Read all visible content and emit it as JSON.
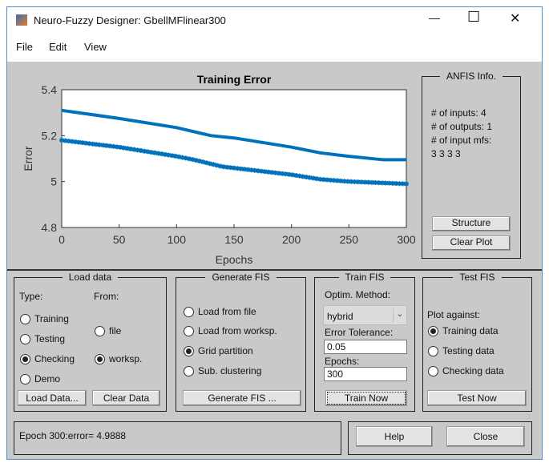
{
  "window": {
    "title": "Neuro-Fuzzy Designer: GbellMFlinear300",
    "minimize": "—",
    "maximize": "☐",
    "close": "✕"
  },
  "menu": [
    "File",
    "Edit",
    "View"
  ],
  "chart_data": {
    "type": "line",
    "title": "Training Error",
    "xlabel": "Epochs",
    "ylabel": "Error",
    "xlim": [
      0,
      300
    ],
    "ylim": [
      4.8,
      5.4
    ],
    "xticks": [
      0,
      50,
      100,
      150,
      200,
      250,
      300
    ],
    "yticks": [
      "4.8",
      "5",
      "5.2",
      "5.4"
    ],
    "color": "#0072bd",
    "series": [
      {
        "marker": "none",
        "x": [
          0,
          50,
          100,
          130,
          150,
          200,
          225,
          250,
          280,
          300
        ],
        "y": [
          5.31,
          5.275,
          5.235,
          5.2,
          5.19,
          5.15,
          5.125,
          5.11,
          5.095,
          5.095
        ]
      },
      {
        "marker": "asterisk",
        "x": [
          0,
          50,
          100,
          115,
          140,
          200,
          225,
          250,
          300
        ],
        "y": [
          5.18,
          5.15,
          5.11,
          5.095,
          5.065,
          5.03,
          5.01,
          5.0,
          4.99
        ]
      }
    ]
  },
  "anfis": {
    "title": "ANFIS Info.",
    "lines": [
      "# of inputs: 4",
      "# of outputs: 1",
      "# of input mfs:",
      "3 3 3 3"
    ],
    "structure": "Structure",
    "clear_plot": "Clear Plot"
  },
  "load": {
    "title": "Load data",
    "type_label": "Type:",
    "from_label": "From:",
    "types": [
      "Training",
      "Testing",
      "Checking",
      "Demo"
    ],
    "type_selected": "Checking",
    "from": [
      "file",
      "worksp."
    ],
    "from_selected": "worksp.",
    "load_btn": "Load Data...",
    "clear_btn": "Clear Data"
  },
  "generate": {
    "title": "Generate FIS",
    "options": [
      "Load from file",
      "Load from worksp.",
      "Grid partition",
      "Sub. clustering"
    ],
    "selected": "Grid partition",
    "btn": "Generate FIS ..."
  },
  "train": {
    "title": "Train FIS",
    "optim_label": "Optim. Method:",
    "optim_value": "hybrid",
    "tol_label": "Error Tolerance:",
    "tol_value": "0.05",
    "epochs_label": "Epochs:",
    "epochs_value": "300",
    "btn": "Train Now"
  },
  "test": {
    "title": "Test FIS",
    "plot_label": "Plot against:",
    "options": [
      "Training data",
      "Testing data",
      "Checking data"
    ],
    "selected": "Training data",
    "btn": "Test Now"
  },
  "status": "Epoch 300:error= 4.9888",
  "help": "Help",
  "close": "Close"
}
